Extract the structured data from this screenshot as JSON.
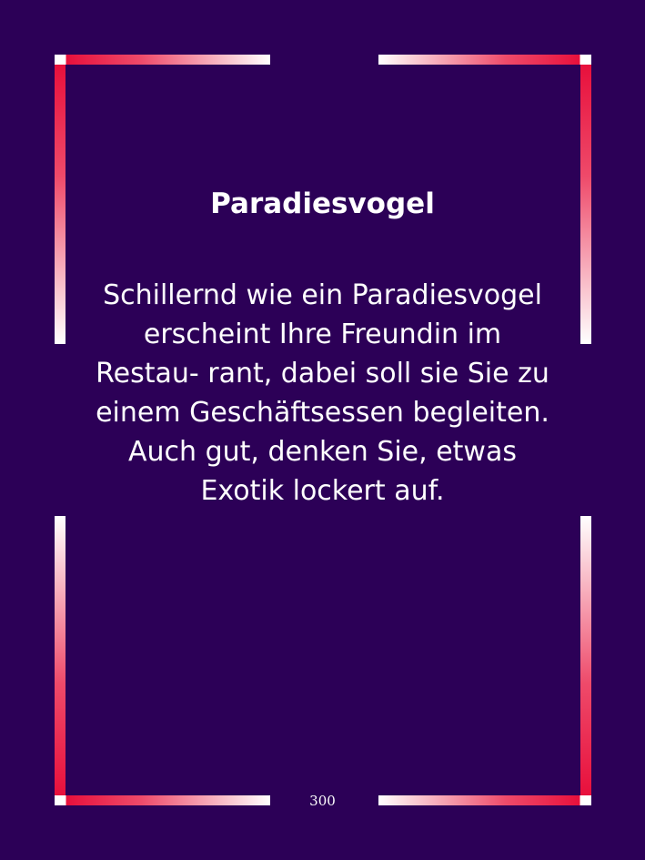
{
  "colors": {
    "background": "#2c0057",
    "frame_accent": "#e8103c",
    "frame_light": "#ffffff",
    "text": "#ffffff"
  },
  "card": {
    "title": "Paradiesvogel",
    "body": "Schillernd wie ein Paradiesvogel erscheint Ihre Freundin im Restau- rant, dabei soll sie Sie zu einem Geschäftsessen begleiten. Auch gut, denken Sie, etwas Exotik lockert auf.",
    "page_number": "300"
  }
}
